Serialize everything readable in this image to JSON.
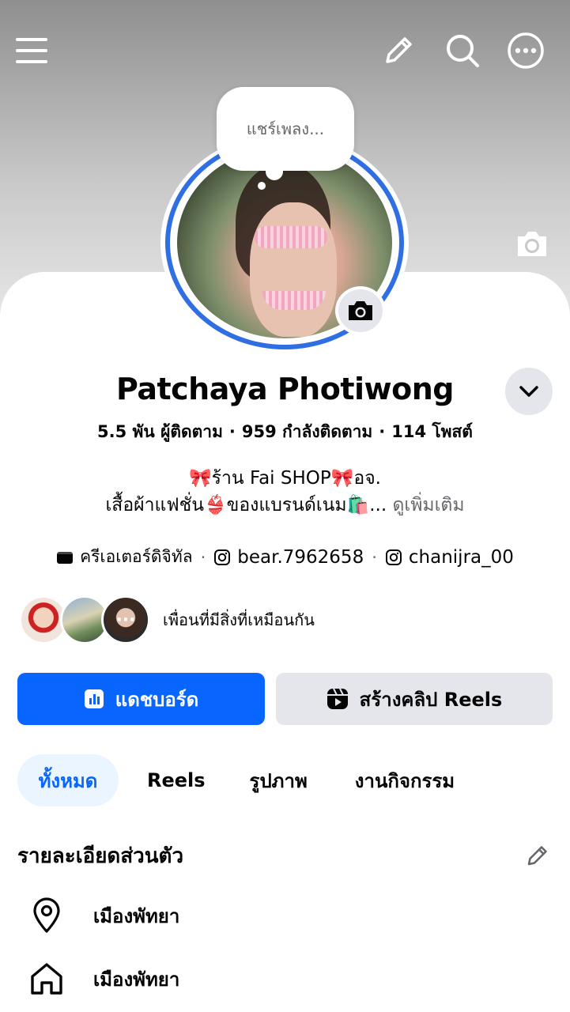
{
  "note": {
    "text": "แชร์เพลง..."
  },
  "profile": {
    "name": "Patchaya Photiwong",
    "stats": {
      "followers": "5.5 พัน ผู้ติดตาม",
      "following": "959 กำลังติดตาม",
      "posts": "114 โพสต์"
    },
    "bio_line1": "🎀ร้าน Fai SHOP🎀อจ.",
    "bio_line2": "เสื้อผ้าแฟชั่น👙ของแบรนด์เนม🛍️...",
    "bio_more": "ดูเพิ่มเติม",
    "links": [
      {
        "icon": "video-icon",
        "label": "ครีเอเตอร์ดิจิทัล"
      },
      {
        "icon": "instagram-icon",
        "label": "bear.7962658"
      },
      {
        "icon": "instagram-icon",
        "label": "chanijra_00"
      }
    ],
    "mutual_text": "เพื่อนที่มีสิ่งที่เหมือนกัน",
    "mutual_more": "···"
  },
  "buttons": {
    "dashboard": "แดชบอร์ด",
    "create_reels": "สร้างคลิป Reels"
  },
  "tabs": [
    "ทั้งหมด",
    "Reels",
    "รูปภาพ",
    "งานกิจกรรม"
  ],
  "details": {
    "title": "รายละเอียดส่วนตัว",
    "items": [
      {
        "icon": "location-pin-icon",
        "text": "เมืองพัทยา"
      },
      {
        "icon": "home-icon",
        "text": "เมืองพัทยา"
      }
    ]
  },
  "colors": {
    "accent": "#0866ff",
    "ring": "#2f6fe3",
    "secondary_button": "#e4e6eb",
    "active_tab_bg": "#ebf5ff"
  }
}
